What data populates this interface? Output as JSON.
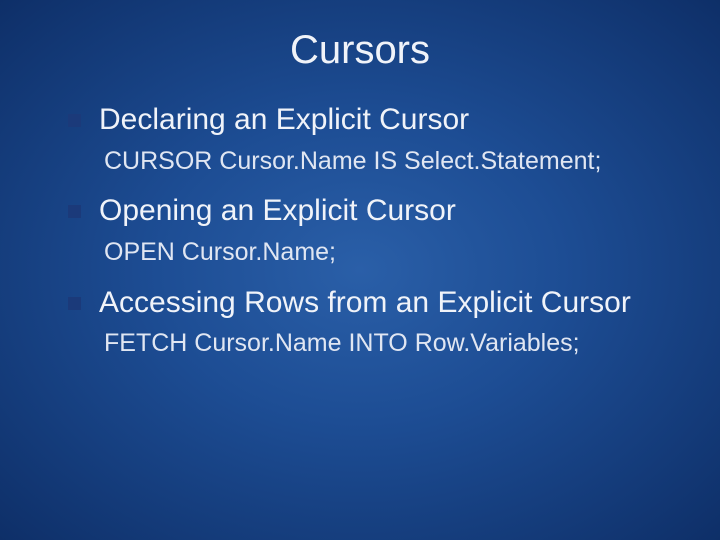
{
  "slide": {
    "title": "Cursors",
    "items": [
      {
        "heading": "Declaring an Explicit Cursor",
        "sub": "CURSOR Cursor.Name IS Select.Statement;"
      },
      {
        "heading": "Opening an Explicit Cursor",
        "sub": "OPEN Cursor.Name;"
      },
      {
        "heading": "Accessing Rows from an Explicit Cursor",
        "sub": "FETCH Cursor.Name INTO Row.Variables;"
      }
    ]
  }
}
